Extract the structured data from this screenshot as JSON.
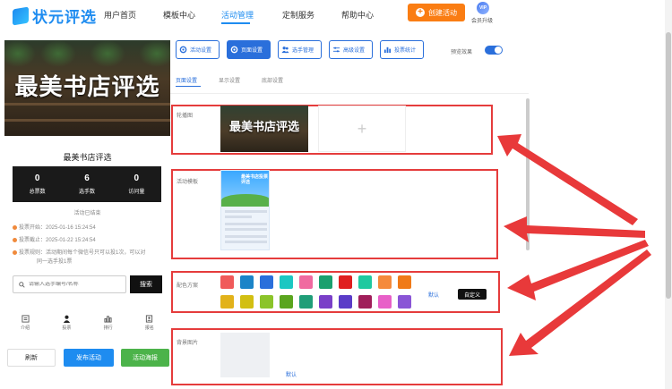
{
  "app": {
    "logo_text": "状元评选"
  },
  "nav": {
    "items": [
      "用户首页",
      "模板中心",
      "活动管理",
      "定制服务",
      "帮助中心"
    ],
    "create_label": "创建活动",
    "vip_badge": "VIP",
    "vip_label": "会员升级"
  },
  "preview": {
    "banner_title": "最美书店评选",
    "card_title": "最美书店评选",
    "stats": [
      {
        "num": "0",
        "label": "总票数"
      },
      {
        "num": "6",
        "label": "选手数"
      },
      {
        "num": "0",
        "label": "访问量"
      }
    ],
    "ended_text": "活动已结束",
    "vote_start": "投票开始：2025-01-16 15:24:54",
    "vote_end": "投票截止：2025-01-22 15:24:54",
    "vote_rule_1": "投票规则：活动期间每个微信号只可以投1次，可以对",
    "vote_rule_2": "同一选手投1票",
    "search_placeholder": "请输入选手编号/名称",
    "search_button": "搜索",
    "tabs": [
      "介绍",
      "投票",
      "排行",
      "报名"
    ],
    "refresh": "刷新",
    "publish": "发布活动",
    "poster": "活动海报"
  },
  "settings": {
    "tabs": [
      "活动设置",
      "页面设置",
      "选手管理",
      "高级设置",
      "投票统计"
    ],
    "preview_effect": "预览效果",
    "subtabs": [
      "页面设置",
      "显示设置",
      "底部设置"
    ],
    "carousel_label": "轮播图",
    "carousel_image_text": "最美书店评选",
    "carousel_add": "+",
    "template_label": "活动模板",
    "template_thumb_title": "最美书店投票评选",
    "color_label": "配色方案",
    "color_default": "默认",
    "color_custom": "自定义",
    "bg_label": "背景图片",
    "bg_default": "默认"
  },
  "colors": {
    "row1": [
      "#f05a5a",
      "#1b84c8",
      "#2a6fdb",
      "#1cc7c2",
      "#f06aa0",
      "#1aa06e",
      "#e01f1f",
      "#1fc9a0",
      "#f58a3c",
      "#f07a18"
    ],
    "row2": [
      "#e2b21a",
      "#d2bf12",
      "#8bc42a",
      "#5aa51e",
      "#1f9e78",
      "#7a3fc8",
      "#5b3cc8",
      "#a01e5a",
      "#e860c8",
      "#8a55d6"
    ]
  }
}
